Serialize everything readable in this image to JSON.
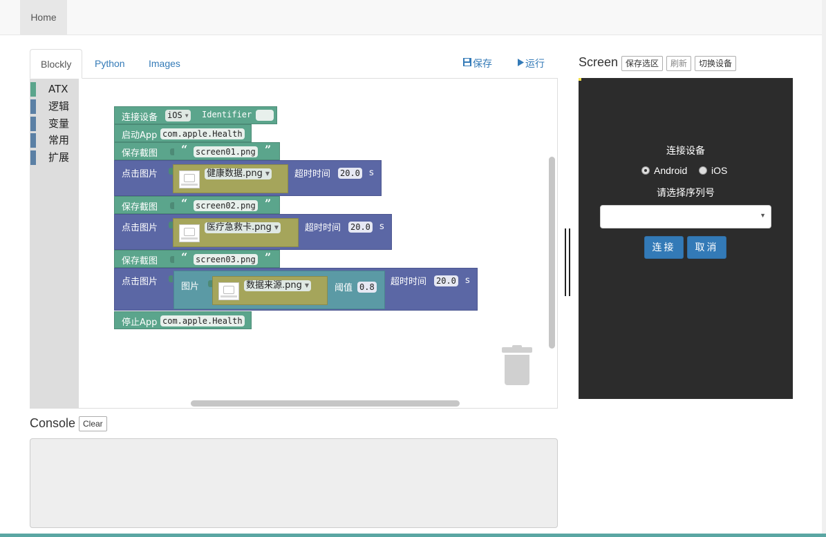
{
  "nav": {
    "home_label": "Home"
  },
  "editor": {
    "tabs": [
      {
        "label": "Blockly",
        "active": true
      },
      {
        "label": "Python",
        "active": false
      },
      {
        "label": "Images",
        "active": false
      }
    ],
    "save_label": "保存",
    "save_icon": "floppy-icon",
    "run_label": "运行",
    "run_icon": "play-icon"
  },
  "toolbox": {
    "items": [
      {
        "label": "ATX",
        "color": "#5ba58c"
      },
      {
        "label": "逻辑",
        "color": "#5b80a5"
      },
      {
        "label": "变量",
        "color": "#5b80a5"
      },
      {
        "label": "常用",
        "color": "#5b80a5"
      },
      {
        "label": "扩展",
        "color": "#5b80a5"
      }
    ]
  },
  "blocks": {
    "connect": {
      "label": "连接设备",
      "platform": "iOS",
      "id_label": "Identifier",
      "id_value": ""
    },
    "launch": {
      "label": "启动App",
      "bundle": "com.apple.Health"
    },
    "snap1": {
      "label": "保存截图",
      "file": "screen01.png"
    },
    "click1": {
      "label": "点击图片",
      "image": "健康数据.png",
      "timeout_label": "超时时间",
      "timeout": "20.0",
      "unit": "s"
    },
    "snap2": {
      "label": "保存截图",
      "file": "screen02.png"
    },
    "click2": {
      "label": "点击图片",
      "image": "医疗急救卡.png",
      "timeout_label": "超时时间",
      "timeout": "20.0",
      "unit": "s"
    },
    "snap3": {
      "label": "保存截图",
      "file": "screen03.png"
    },
    "click3": {
      "label": "点击图片",
      "inner_label": "图片",
      "image": "数据来源.png",
      "threshold_label": "阈值",
      "threshold": "0.8",
      "timeout_label": "超时时间",
      "timeout": "20.0",
      "unit": "s"
    },
    "stop": {
      "label": "停止App",
      "bundle": "com.apple.Health"
    }
  },
  "screen": {
    "title": "Screen",
    "save_region_label": "保存选区",
    "refresh_label": "刷新",
    "switch_device_label": "切换设备",
    "connect_title": "连接设备",
    "platforms": [
      {
        "label": "Android",
        "checked": true
      },
      {
        "label": "iOS",
        "checked": false
      }
    ],
    "serial_label": "请选择序列号",
    "serial_value": "",
    "connect_btn": "连接",
    "cancel_btn": "取消"
  },
  "console": {
    "title": "Console",
    "clear_label": "Clear",
    "output": ""
  }
}
